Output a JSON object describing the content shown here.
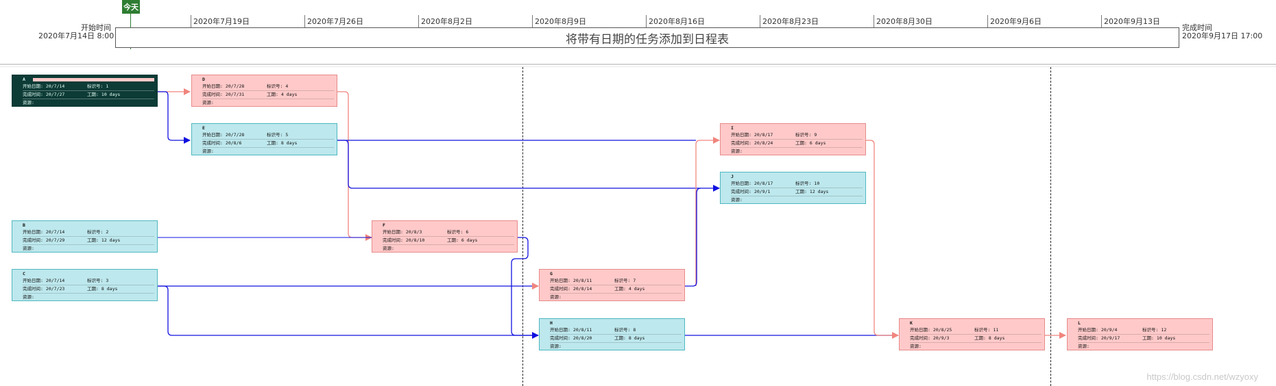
{
  "timeline": {
    "today_label": "今天",
    "start_title": "开始时间",
    "start_value": "2020年7月14日  8:00",
    "finish_title": "完成时间",
    "finish_value": "2020年9月17日  17:00",
    "bar_text": "将带有日期的任务添加到日程表",
    "dates": [
      "2020年7月19日",
      "2020年7月26日",
      "2020年8月2日",
      "2020年8月9日",
      "2020年8月16日",
      "2020年8月23日",
      "2020年8月30日",
      "2020年9月6日",
      "2020年9月13日"
    ]
  },
  "labels": {
    "start": "开始日期:",
    "id": "标识号:",
    "finish": "完成时间:",
    "duration": "工期:",
    "resource": "资源:"
  },
  "colors": {
    "critical_fill": "#ffc9c9",
    "critical_link": "#f0857d",
    "normal_fill": "#bde8ed",
    "normal_link": "#1010e0",
    "selected_fill": "#0d3b36",
    "today_flag": "#2e7d32"
  },
  "nodes": {
    "A": {
      "name": "A",
      "start": "20/7/14",
      "id": "1",
      "finish": "20/7/27",
      "duration": "10 days",
      "resource": ""
    },
    "B": {
      "name": "B",
      "start": "20/7/14",
      "id": "2",
      "finish": "20/7/29",
      "duration": "12 days",
      "resource": ""
    },
    "C": {
      "name": "C",
      "start": "20/7/14",
      "id": "3",
      "finish": "20/7/23",
      "duration": "8 days",
      "resource": ""
    },
    "D": {
      "name": "D",
      "start": "20/7/28",
      "id": "4",
      "finish": "20/7/31",
      "duration": "4 days",
      "resource": ""
    },
    "E": {
      "name": "E",
      "start": "20/7/28",
      "id": "5",
      "finish": "20/8/6",
      "duration": "8 days",
      "resource": ""
    },
    "F": {
      "name": "F",
      "start": "20/8/3",
      "id": "6",
      "finish": "20/8/10",
      "duration": "6 days",
      "resource": ""
    },
    "G": {
      "name": "G",
      "start": "20/8/11",
      "id": "7",
      "finish": "20/8/14",
      "duration": "4 days",
      "resource": ""
    },
    "H": {
      "name": "H",
      "start": "20/8/11",
      "id": "8",
      "finish": "20/8/20",
      "duration": "8 days",
      "resource": ""
    },
    "I": {
      "name": "I",
      "start": "20/8/17",
      "id": "9",
      "finish": "20/8/24",
      "duration": "6 days",
      "resource": ""
    },
    "J": {
      "name": "J",
      "start": "20/8/17",
      "id": "10",
      "finish": "20/9/1",
      "duration": "12 days",
      "resource": ""
    },
    "K": {
      "name": "K",
      "start": "20/8/25",
      "id": "11",
      "finish": "20/9/3",
      "duration": "8 days",
      "resource": ""
    },
    "L": {
      "name": "L",
      "start": "20/9/4",
      "id": "12",
      "finish": "20/9/17",
      "duration": "10 days",
      "resource": ""
    }
  },
  "watermark": "https://blog.csdn.net/wzyoxy"
}
